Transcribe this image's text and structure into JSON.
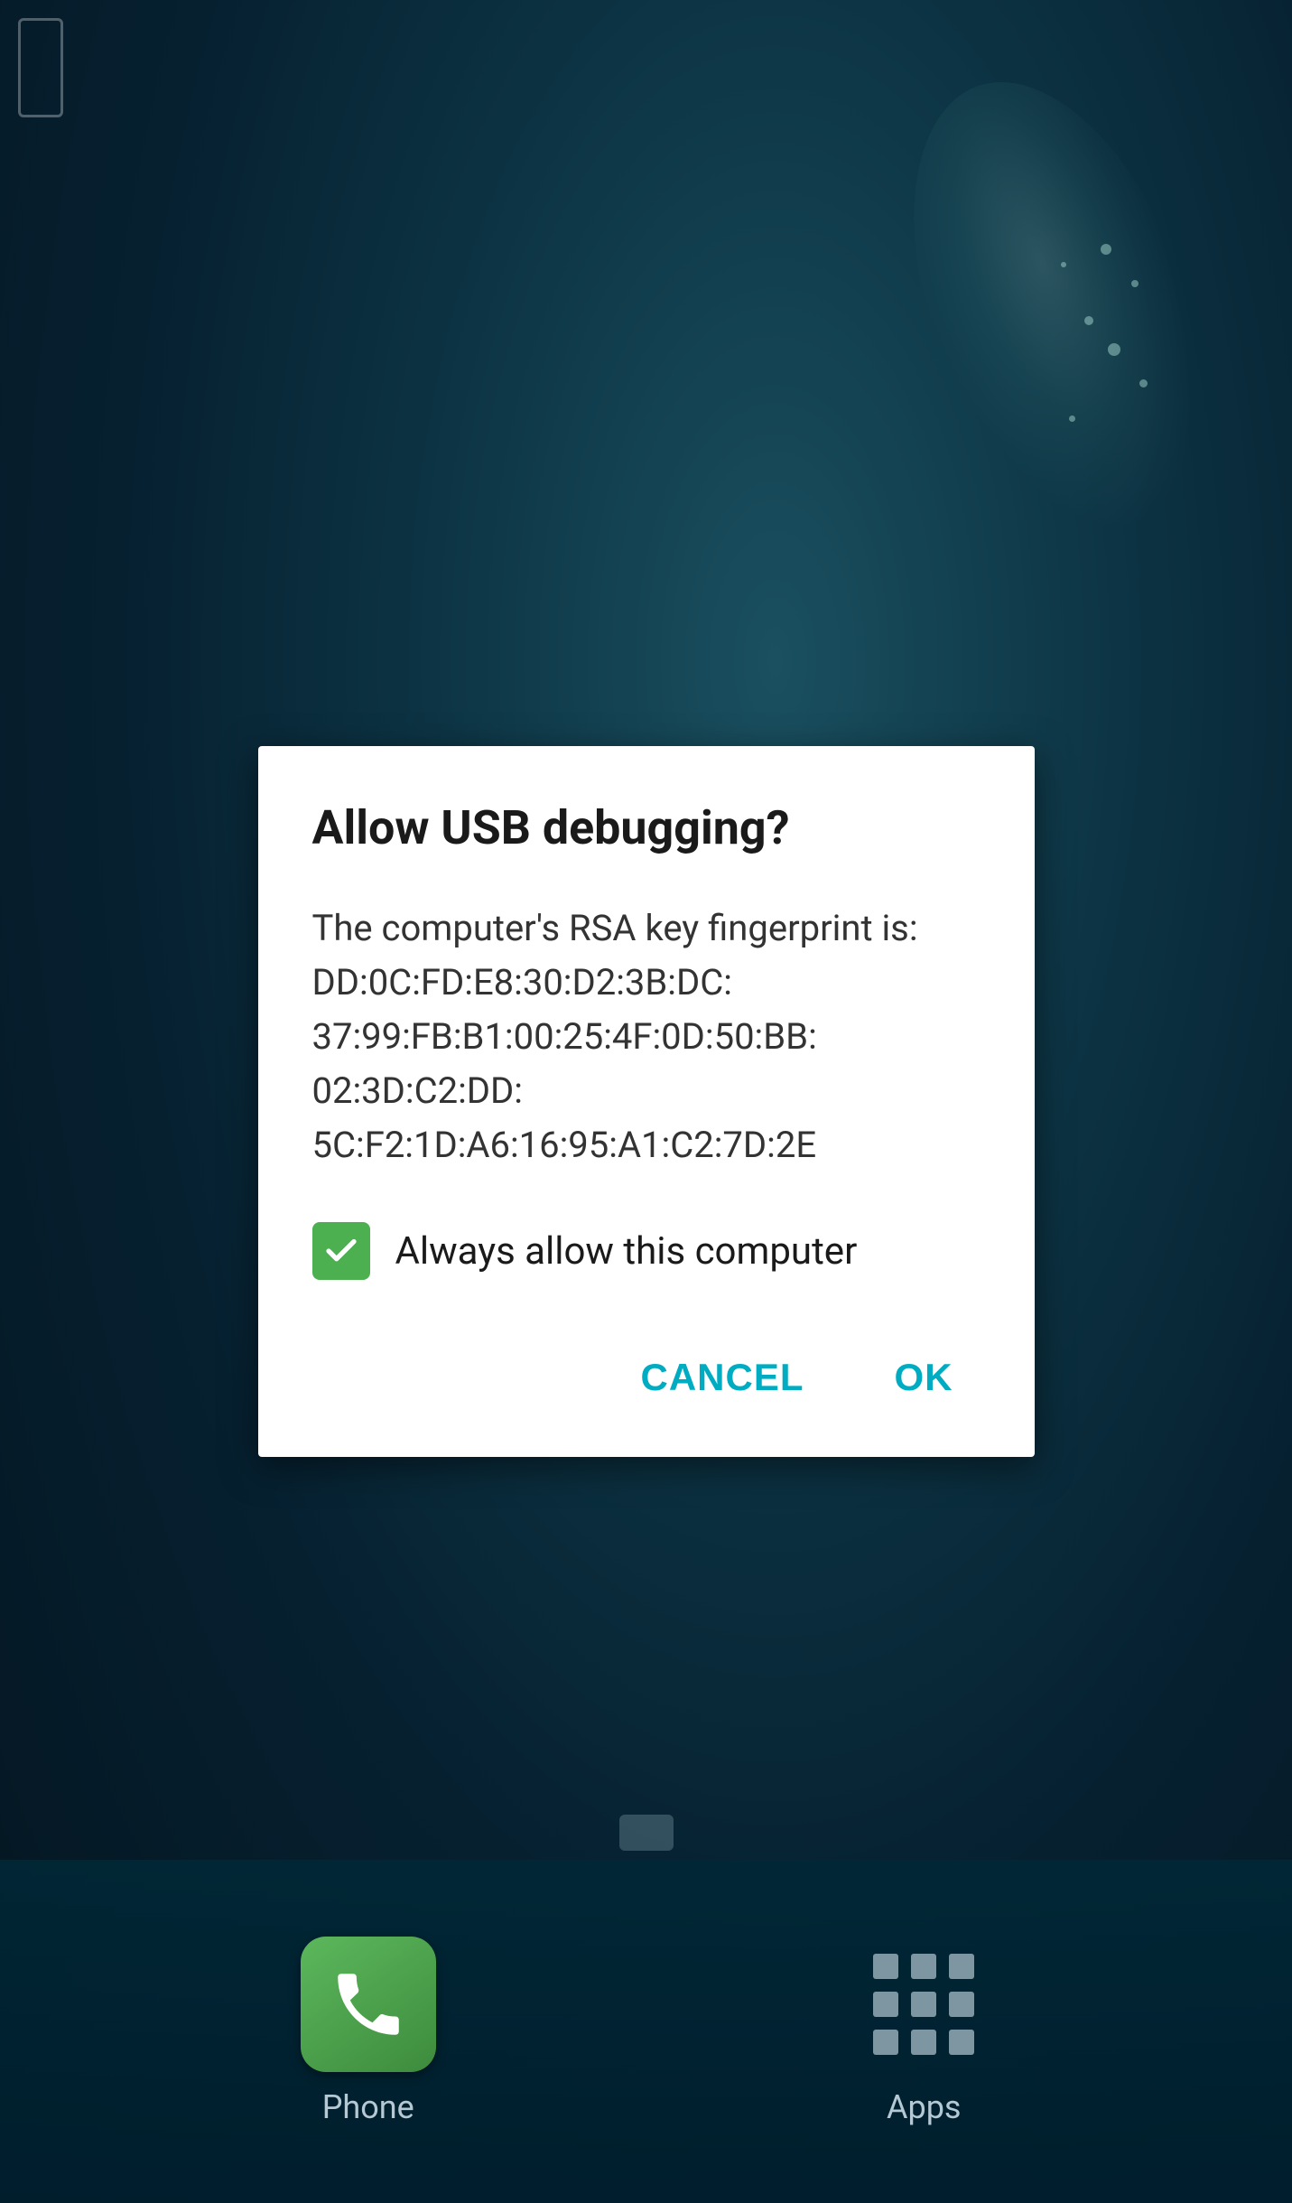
{
  "wallpaper": {
    "alt": "Dark teal Android wallpaper"
  },
  "topLeftRect": {
    "visible": true
  },
  "dialog": {
    "title": "Allow USB debugging?",
    "body": "The computer's RSA key fingerprint is:\nDD:0C:FD:E8:30:D2:3B:DC:\n37:99:FB:B1:00:25:4F:0D:50:BB:\n02:3D:C2:DD:\n5C:F2:1D:A6:16:95:A1:C2:7D:2E",
    "checkbox": {
      "checked": true,
      "label": "Always allow this computer"
    },
    "buttons": {
      "cancel": "CANCEL",
      "ok": "OK"
    }
  },
  "navbar": {
    "phone": {
      "label": "Phone"
    },
    "apps": {
      "label": "Apps"
    }
  }
}
